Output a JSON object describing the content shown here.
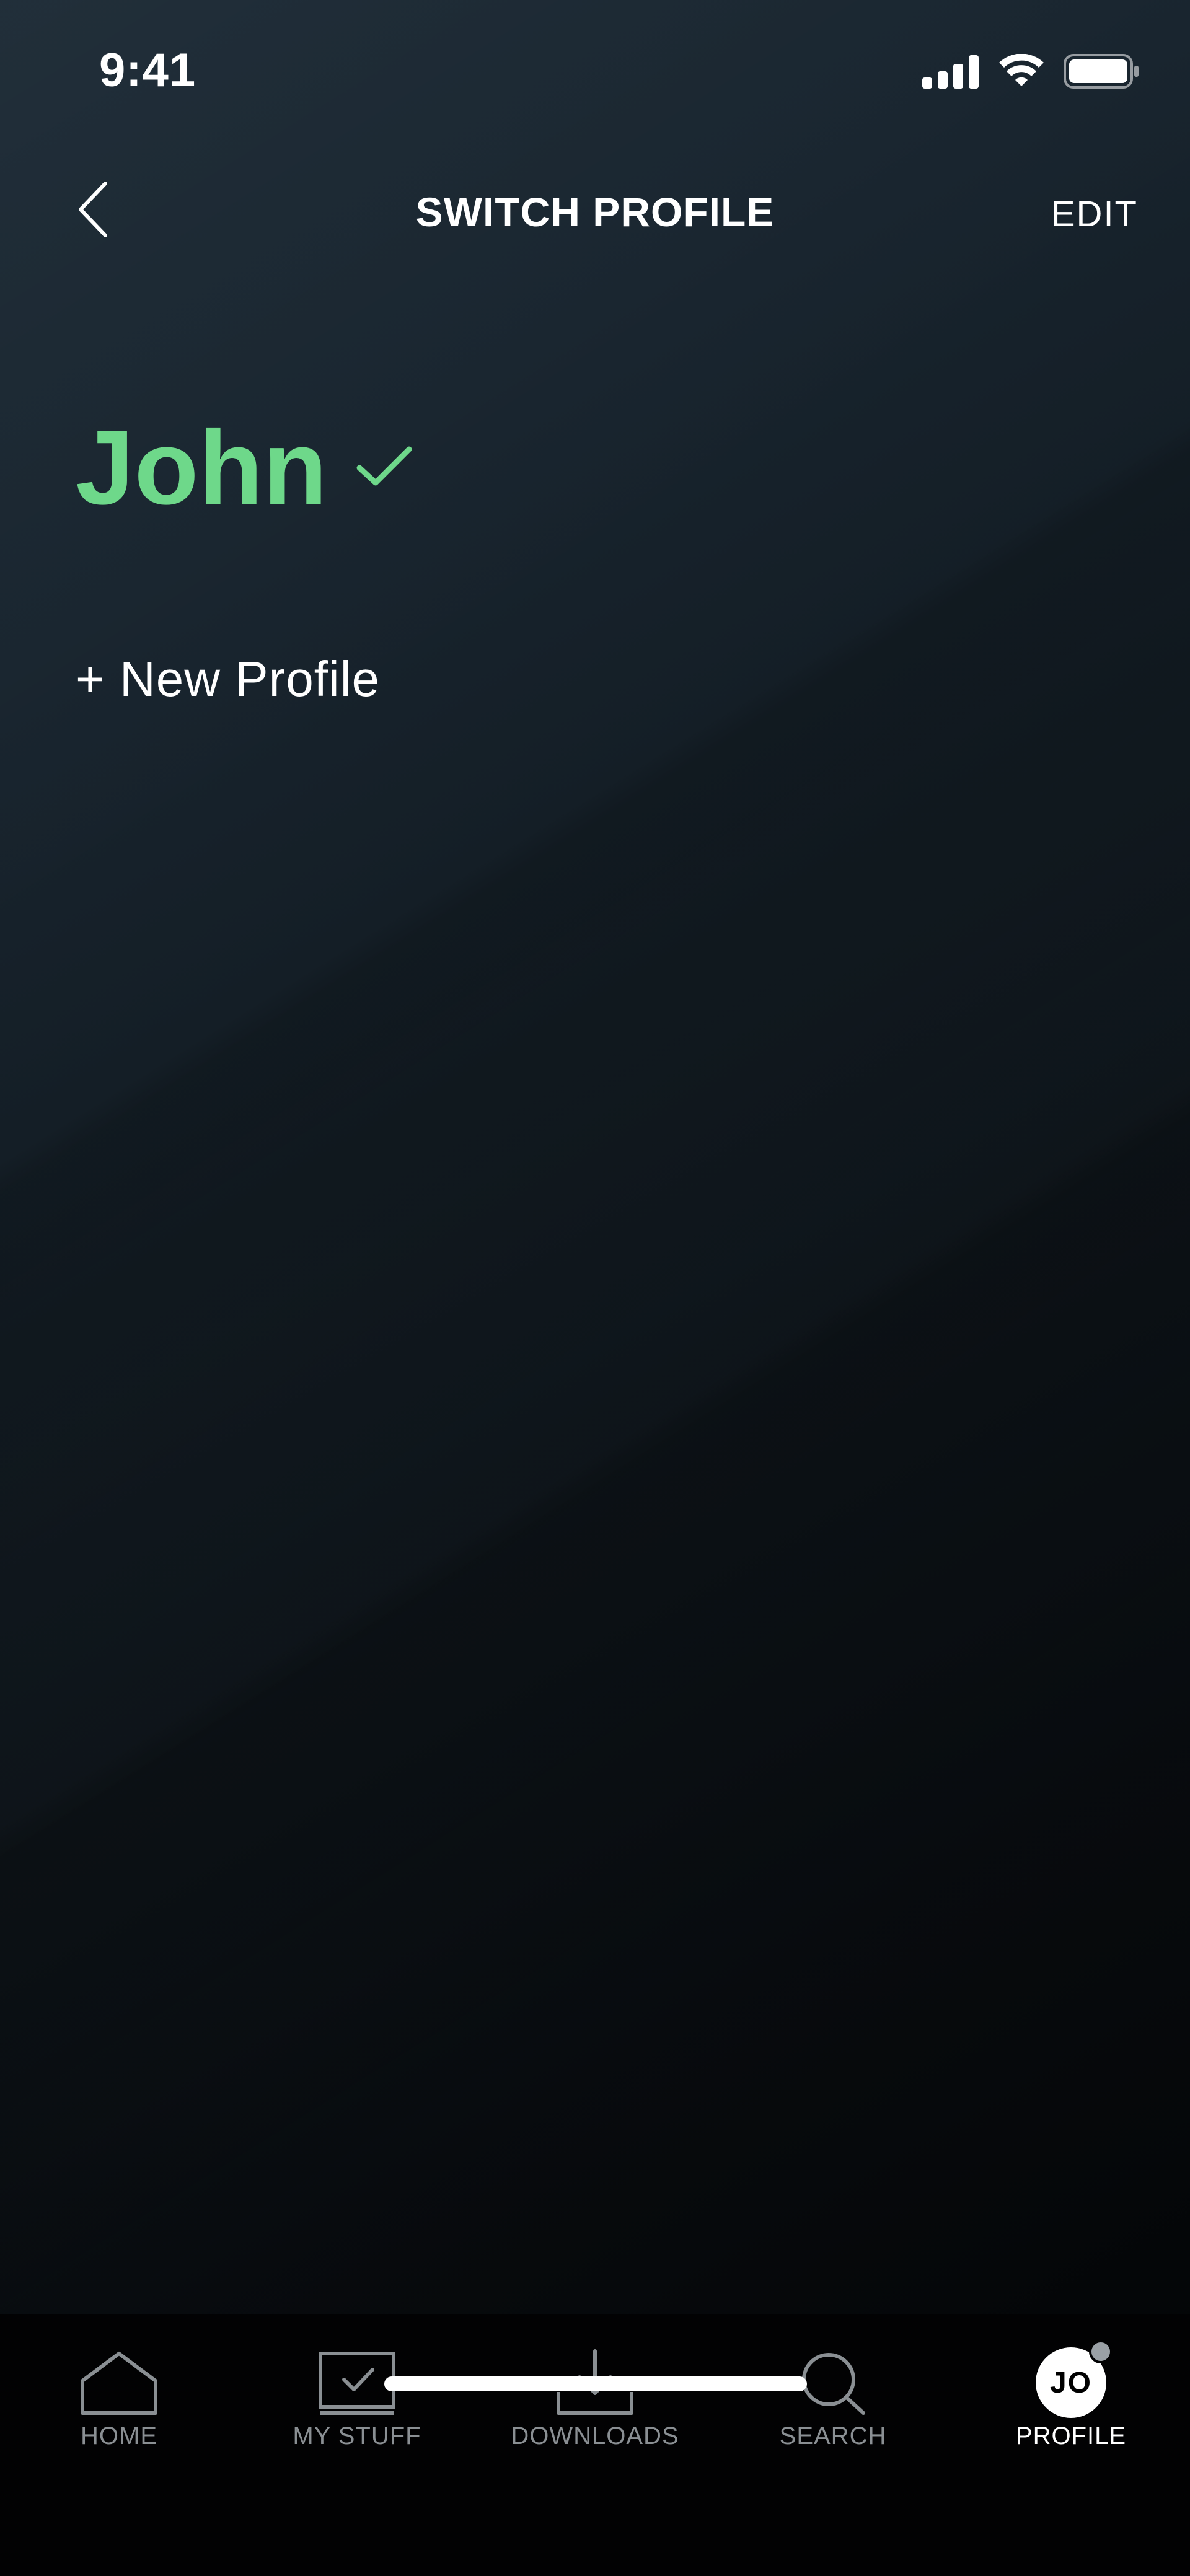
{
  "status_bar": {
    "time": "9:41",
    "icons": [
      "signal-icon",
      "wifi-icon",
      "battery-icon"
    ]
  },
  "nav": {
    "back_icon": "chevron-left-icon",
    "title": "SWITCH PROFILE",
    "edit_label": "EDIT"
  },
  "profiles": {
    "current": {
      "name": "John",
      "selected_icon": "checkmark-icon"
    },
    "new_profile_label": "+ New Profile"
  },
  "tab_bar": {
    "tabs": [
      {
        "label": "HOME",
        "icon": "home-icon",
        "active": false
      },
      {
        "label": "MY STUFF",
        "icon": "my-stuff-icon",
        "active": false
      },
      {
        "label": "DOWNLOADS",
        "icon": "download-icon",
        "active": false
      },
      {
        "label": "SEARCH",
        "icon": "search-icon",
        "active": false
      },
      {
        "label": "PROFILE",
        "icon": "avatar",
        "active": true,
        "avatar_initials": "JO"
      }
    ]
  },
  "colors": {
    "accent_green": "#6ed88a",
    "background_top": "#1c2a35",
    "background_bottom": "#020304",
    "tab_inactive": "#8a8f93",
    "tab_active": "#ffffff"
  }
}
